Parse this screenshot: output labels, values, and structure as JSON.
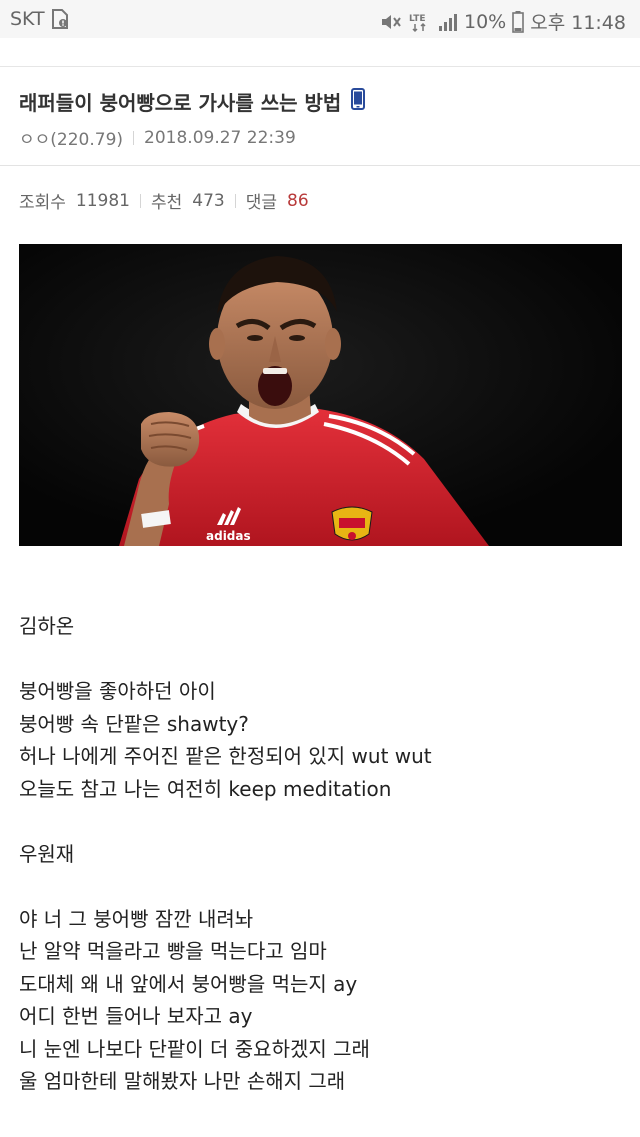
{
  "status_bar": {
    "carrier": "SKT",
    "network": "LTE",
    "battery_percent": "10%",
    "time": "오후 11:48",
    "icons": [
      "sim-alert-icon",
      "mute-icon",
      "lte-icon",
      "signal-icon",
      "battery-icon"
    ]
  },
  "post": {
    "title": "래퍼들이 붕어빵으로 가사를 쓰는 방법",
    "title_icon": "mobile-phone-icon",
    "author": "ㅇㅇ(220.79)",
    "datetime": "2018.09.27 22:39",
    "stats": {
      "views_label": "조회수",
      "views": "11981",
      "recommend_label": "추천",
      "recommend": "473",
      "comments_label": "댓글",
      "comments": "86"
    },
    "image": {
      "subject": "football-player-celebrating-photo",
      "badge_text": "adidas"
    },
    "body_lines": [
      "김하온",
      "",
      "붕어빵을 좋아하던 아이",
      "붕어빵 속 단팥은 shawty?",
      "허나 나에게 주어진 팥은 한정되어 있지 wut wut",
      "오늘도 참고 나는 여전히 keep meditation",
      "",
      "우원재",
      "",
      "야 너 그 붕어빵 잠깐 내려놔",
      "난 알약 먹을라고 빵을 먹는다고 임마",
      "도대체 왜 내 앞에서 붕어빵을 먹는지 ay",
      "어디 한번 들어나 보자고 ay",
      "니 눈엔 나보다 단팥이 더 중요하겠지 그래",
      "울 엄마한테 말해봤자 나만 손해지 그래"
    ]
  },
  "colors": {
    "status_bg": "#f6f6f6",
    "text": "#222222",
    "meta": "#777777",
    "comment_count": "#b83a3a",
    "phone_icon": "#2a4b9b",
    "jersey_red": "#d3212d"
  }
}
